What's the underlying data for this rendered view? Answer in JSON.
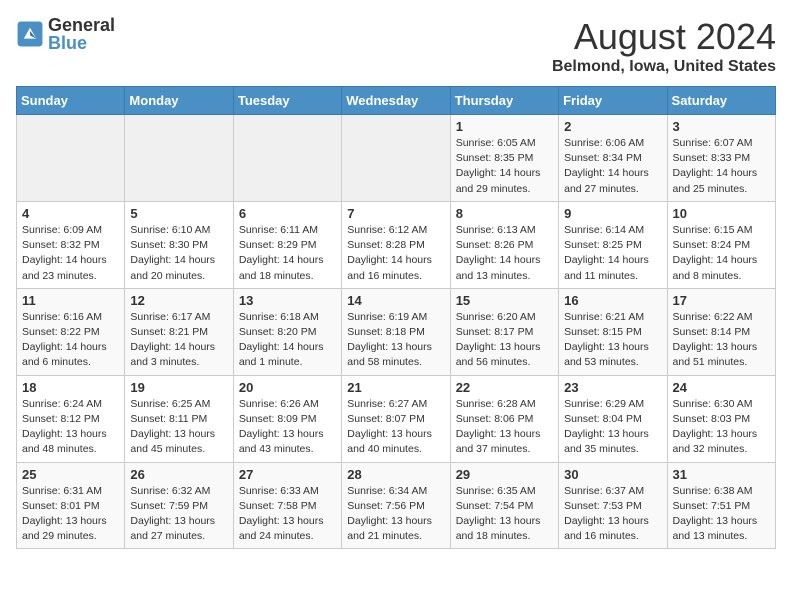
{
  "header": {
    "logo_general": "General",
    "logo_blue": "Blue",
    "title": "August 2024",
    "subtitle": "Belmond, Iowa, United States"
  },
  "calendar": {
    "weekdays": [
      "Sunday",
      "Monday",
      "Tuesday",
      "Wednesday",
      "Thursday",
      "Friday",
      "Saturday"
    ],
    "weeks": [
      [
        {
          "day": "",
          "sunrise": "",
          "sunset": "",
          "daylight": ""
        },
        {
          "day": "",
          "sunrise": "",
          "sunset": "",
          "daylight": ""
        },
        {
          "day": "",
          "sunrise": "",
          "sunset": "",
          "daylight": ""
        },
        {
          "day": "",
          "sunrise": "",
          "sunset": "",
          "daylight": ""
        },
        {
          "day": "1",
          "sunrise": "Sunrise: 6:05 AM",
          "sunset": "Sunset: 8:35 PM",
          "daylight": "Daylight: 14 hours and 29 minutes."
        },
        {
          "day": "2",
          "sunrise": "Sunrise: 6:06 AM",
          "sunset": "Sunset: 8:34 PM",
          "daylight": "Daylight: 14 hours and 27 minutes."
        },
        {
          "day": "3",
          "sunrise": "Sunrise: 6:07 AM",
          "sunset": "Sunset: 8:33 PM",
          "daylight": "Daylight: 14 hours and 25 minutes."
        }
      ],
      [
        {
          "day": "4",
          "sunrise": "Sunrise: 6:09 AM",
          "sunset": "Sunset: 8:32 PM",
          "daylight": "Daylight: 14 hours and 23 minutes."
        },
        {
          "day": "5",
          "sunrise": "Sunrise: 6:10 AM",
          "sunset": "Sunset: 8:30 PM",
          "daylight": "Daylight: 14 hours and 20 minutes."
        },
        {
          "day": "6",
          "sunrise": "Sunrise: 6:11 AM",
          "sunset": "Sunset: 8:29 PM",
          "daylight": "Daylight: 14 hours and 18 minutes."
        },
        {
          "day": "7",
          "sunrise": "Sunrise: 6:12 AM",
          "sunset": "Sunset: 8:28 PM",
          "daylight": "Daylight: 14 hours and 16 minutes."
        },
        {
          "day": "8",
          "sunrise": "Sunrise: 6:13 AM",
          "sunset": "Sunset: 8:26 PM",
          "daylight": "Daylight: 14 hours and 13 minutes."
        },
        {
          "day": "9",
          "sunrise": "Sunrise: 6:14 AM",
          "sunset": "Sunset: 8:25 PM",
          "daylight": "Daylight: 14 hours and 11 minutes."
        },
        {
          "day": "10",
          "sunrise": "Sunrise: 6:15 AM",
          "sunset": "Sunset: 8:24 PM",
          "daylight": "Daylight: 14 hours and 8 minutes."
        }
      ],
      [
        {
          "day": "11",
          "sunrise": "Sunrise: 6:16 AM",
          "sunset": "Sunset: 8:22 PM",
          "daylight": "Daylight: 14 hours and 6 minutes."
        },
        {
          "day": "12",
          "sunrise": "Sunrise: 6:17 AM",
          "sunset": "Sunset: 8:21 PM",
          "daylight": "Daylight: 14 hours and 3 minutes."
        },
        {
          "day": "13",
          "sunrise": "Sunrise: 6:18 AM",
          "sunset": "Sunset: 8:20 PM",
          "daylight": "Daylight: 14 hours and 1 minute."
        },
        {
          "day": "14",
          "sunrise": "Sunrise: 6:19 AM",
          "sunset": "Sunset: 8:18 PM",
          "daylight": "Daylight: 13 hours and 58 minutes."
        },
        {
          "day": "15",
          "sunrise": "Sunrise: 6:20 AM",
          "sunset": "Sunset: 8:17 PM",
          "daylight": "Daylight: 13 hours and 56 minutes."
        },
        {
          "day": "16",
          "sunrise": "Sunrise: 6:21 AM",
          "sunset": "Sunset: 8:15 PM",
          "daylight": "Daylight: 13 hours and 53 minutes."
        },
        {
          "day": "17",
          "sunrise": "Sunrise: 6:22 AM",
          "sunset": "Sunset: 8:14 PM",
          "daylight": "Daylight: 13 hours and 51 minutes."
        }
      ],
      [
        {
          "day": "18",
          "sunrise": "Sunrise: 6:24 AM",
          "sunset": "Sunset: 8:12 PM",
          "daylight": "Daylight: 13 hours and 48 minutes."
        },
        {
          "day": "19",
          "sunrise": "Sunrise: 6:25 AM",
          "sunset": "Sunset: 8:11 PM",
          "daylight": "Daylight: 13 hours and 45 minutes."
        },
        {
          "day": "20",
          "sunrise": "Sunrise: 6:26 AM",
          "sunset": "Sunset: 8:09 PM",
          "daylight": "Daylight: 13 hours and 43 minutes."
        },
        {
          "day": "21",
          "sunrise": "Sunrise: 6:27 AM",
          "sunset": "Sunset: 8:07 PM",
          "daylight": "Daylight: 13 hours and 40 minutes."
        },
        {
          "day": "22",
          "sunrise": "Sunrise: 6:28 AM",
          "sunset": "Sunset: 8:06 PM",
          "daylight": "Daylight: 13 hours and 37 minutes."
        },
        {
          "day": "23",
          "sunrise": "Sunrise: 6:29 AM",
          "sunset": "Sunset: 8:04 PM",
          "daylight": "Daylight: 13 hours and 35 minutes."
        },
        {
          "day": "24",
          "sunrise": "Sunrise: 6:30 AM",
          "sunset": "Sunset: 8:03 PM",
          "daylight": "Daylight: 13 hours and 32 minutes."
        }
      ],
      [
        {
          "day": "25",
          "sunrise": "Sunrise: 6:31 AM",
          "sunset": "Sunset: 8:01 PM",
          "daylight": "Daylight: 13 hours and 29 minutes."
        },
        {
          "day": "26",
          "sunrise": "Sunrise: 6:32 AM",
          "sunset": "Sunset: 7:59 PM",
          "daylight": "Daylight: 13 hours and 27 minutes."
        },
        {
          "day": "27",
          "sunrise": "Sunrise: 6:33 AM",
          "sunset": "Sunset: 7:58 PM",
          "daylight": "Daylight: 13 hours and 24 minutes."
        },
        {
          "day": "28",
          "sunrise": "Sunrise: 6:34 AM",
          "sunset": "Sunset: 7:56 PM",
          "daylight": "Daylight: 13 hours and 21 minutes."
        },
        {
          "day": "29",
          "sunrise": "Sunrise: 6:35 AM",
          "sunset": "Sunset: 7:54 PM",
          "daylight": "Daylight: 13 hours and 18 minutes."
        },
        {
          "day": "30",
          "sunrise": "Sunrise: 6:37 AM",
          "sunset": "Sunset: 7:53 PM",
          "daylight": "Daylight: 13 hours and 16 minutes."
        },
        {
          "day": "31",
          "sunrise": "Sunrise: 6:38 AM",
          "sunset": "Sunset: 7:51 PM",
          "daylight": "Daylight: 13 hours and 13 minutes."
        }
      ]
    ]
  }
}
